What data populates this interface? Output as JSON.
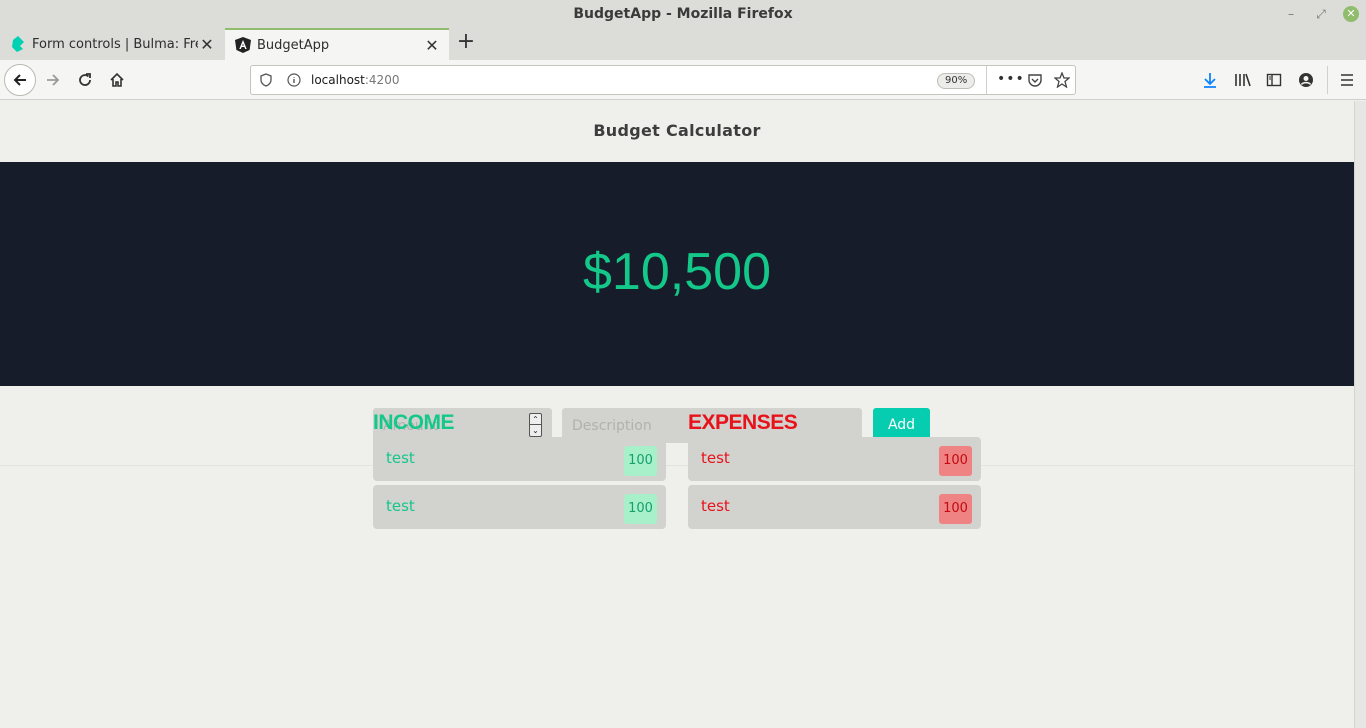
{
  "window": {
    "title": "BudgetApp - Mozilla Firefox"
  },
  "tabs": [
    {
      "label": "Form controls | Bulma: Free,",
      "icon": "bulma-logo-icon",
      "active": false
    },
    {
      "label": "BudgetApp",
      "icon": "angular-logo-icon",
      "active": true
    }
  ],
  "urlbar": {
    "host": "localhost",
    "port": ":4200",
    "zoom": "90%"
  },
  "app": {
    "title": "Budget Calculator",
    "total": "$10,500",
    "form": {
      "amount_placeholder": "Amount",
      "description_placeholder": "Description",
      "add_label": "Add"
    },
    "income": {
      "heading": "INCOME",
      "items": [
        {
          "description": "test",
          "amount": "100"
        },
        {
          "description": "test",
          "amount": "100"
        }
      ]
    },
    "expenses": {
      "heading": "EXPENSES",
      "items": [
        {
          "description": "test",
          "amount": "100"
        },
        {
          "description": "test",
          "amount": "100"
        }
      ]
    }
  },
  "colors": {
    "income": "#14c88a",
    "expense": "#e8121b",
    "hero_bg": "#161c2a",
    "add_button": "#06cdb0"
  }
}
